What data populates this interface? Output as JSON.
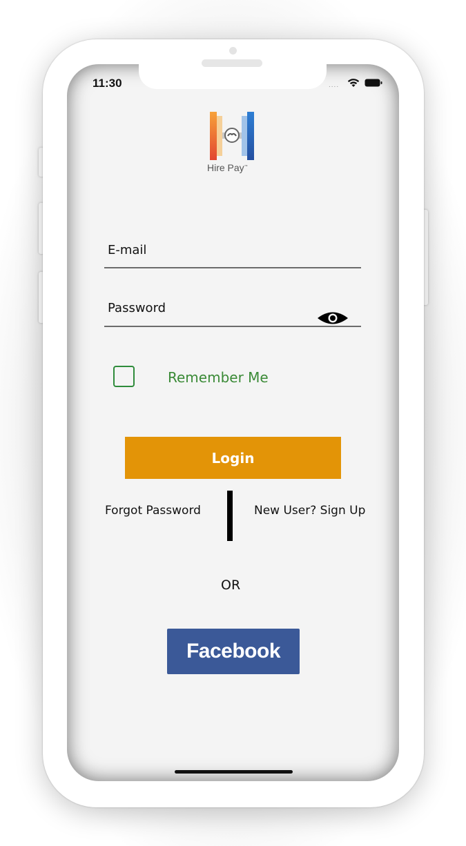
{
  "status_bar": {
    "time": "11:30",
    "signal_dots": "....",
    "wifi_icon": "wifi-icon",
    "battery_icon": "battery-icon"
  },
  "logo": {
    "text": "Hire Pay",
    "trademark": "™",
    "colors": {
      "orange": "#f08a24",
      "blue": "#2f6fc4",
      "red": "#e2452f"
    }
  },
  "form": {
    "email_label": "E-mail",
    "password_label": "Password",
    "show_password_icon": "eye-icon",
    "remember_label": "Remember Me",
    "remember_checked": false,
    "login_label": "Login"
  },
  "links": {
    "forgot_password": "Forgot Password",
    "sign_up": "New User? Sign Up"
  },
  "separator_text": "OR",
  "social": {
    "facebook_label": "Facebook"
  },
  "colors": {
    "login_button": "#e39407",
    "facebook_button": "#3b5998",
    "remember_green": "#3a8a36",
    "screen_bg": "#f4f4f4"
  }
}
